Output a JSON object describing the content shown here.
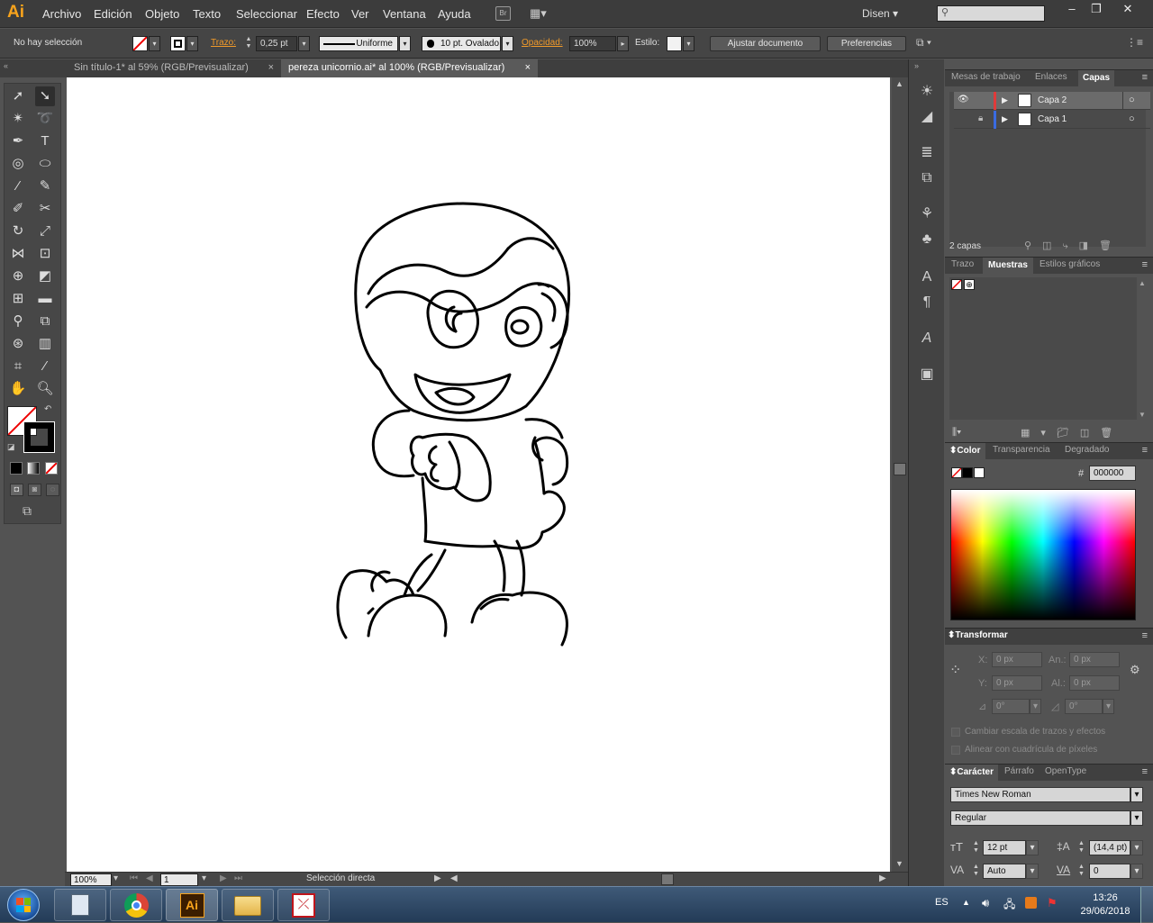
{
  "app": {
    "logo": "Ai",
    "brand_color": "#f7a31c"
  },
  "menu": [
    "Archivo",
    "Edición",
    "Objeto",
    "Texto",
    "Seleccionar",
    "Efecto",
    "Ver",
    "Ventana",
    "Ayuda"
  ],
  "topbar": {
    "bridge_label": "Br",
    "workspace": "Disen",
    "search_placeholder": ""
  },
  "control": {
    "selection": "No hay selección",
    "stroke_label": "Trazo:",
    "stroke_weight": "0,25 pt",
    "profile": "Uniforme",
    "brush": "10 pt. Ovalado",
    "opacity_label": "Opacidad:",
    "opacity": "100%",
    "style_label": "Estilo:",
    "fit_button": "Ajustar documento",
    "prefs_button": "Preferencias"
  },
  "tabs": [
    {
      "title": "Sin título-1* al 59% (RGB/Previsualizar)",
      "close": "×"
    },
    {
      "title": "pereza unicornio.ai* al 100% (RGB/Previsualizar)",
      "close": "×"
    }
  ],
  "status": {
    "zoom": "100%",
    "artboard": "1",
    "tool": "Selección directa"
  },
  "layers_panel": {
    "tabs": [
      "Mesas de trabajo",
      "Enlaces",
      "Capas"
    ],
    "layers": [
      {
        "name": "Capa 2",
        "color": "#e03a3a"
      },
      {
        "name": "Capa 1",
        "color": "#3a6be0"
      }
    ],
    "count": "2 capas"
  },
  "swatches_panel": {
    "tabs": [
      "Trazo",
      "Muestras",
      "Estilos gráficos"
    ]
  },
  "color_panel": {
    "tabs": [
      "Color",
      "Transparencia",
      "Degradado"
    ],
    "hex_label": "#",
    "hex": "000000"
  },
  "transform_panel": {
    "title": "Transformar",
    "x_label": "X:",
    "x": "0 px",
    "w_label": "An.:",
    "w": "0 px",
    "y_label": "Y:",
    "y": "0 px",
    "h_label": "Al.:",
    "h": "0 px",
    "angle": "0°",
    "shear": "0°",
    "scale_strokes": "Cambiar escala de trazos y efectos",
    "align_pixels": "Alinear con cuadrícula de píxeles"
  },
  "character_panel": {
    "tabs": [
      "Carácter",
      "Párrafo",
      "OpenType"
    ],
    "font": "Times New Roman",
    "style": "Regular",
    "size": "12 pt",
    "leading": "(14,4 pt)",
    "kerning": "Auto",
    "tracking": "0"
  },
  "taskbar": {
    "lang": "ES",
    "time": "13:26",
    "date": "29/06/2018"
  }
}
